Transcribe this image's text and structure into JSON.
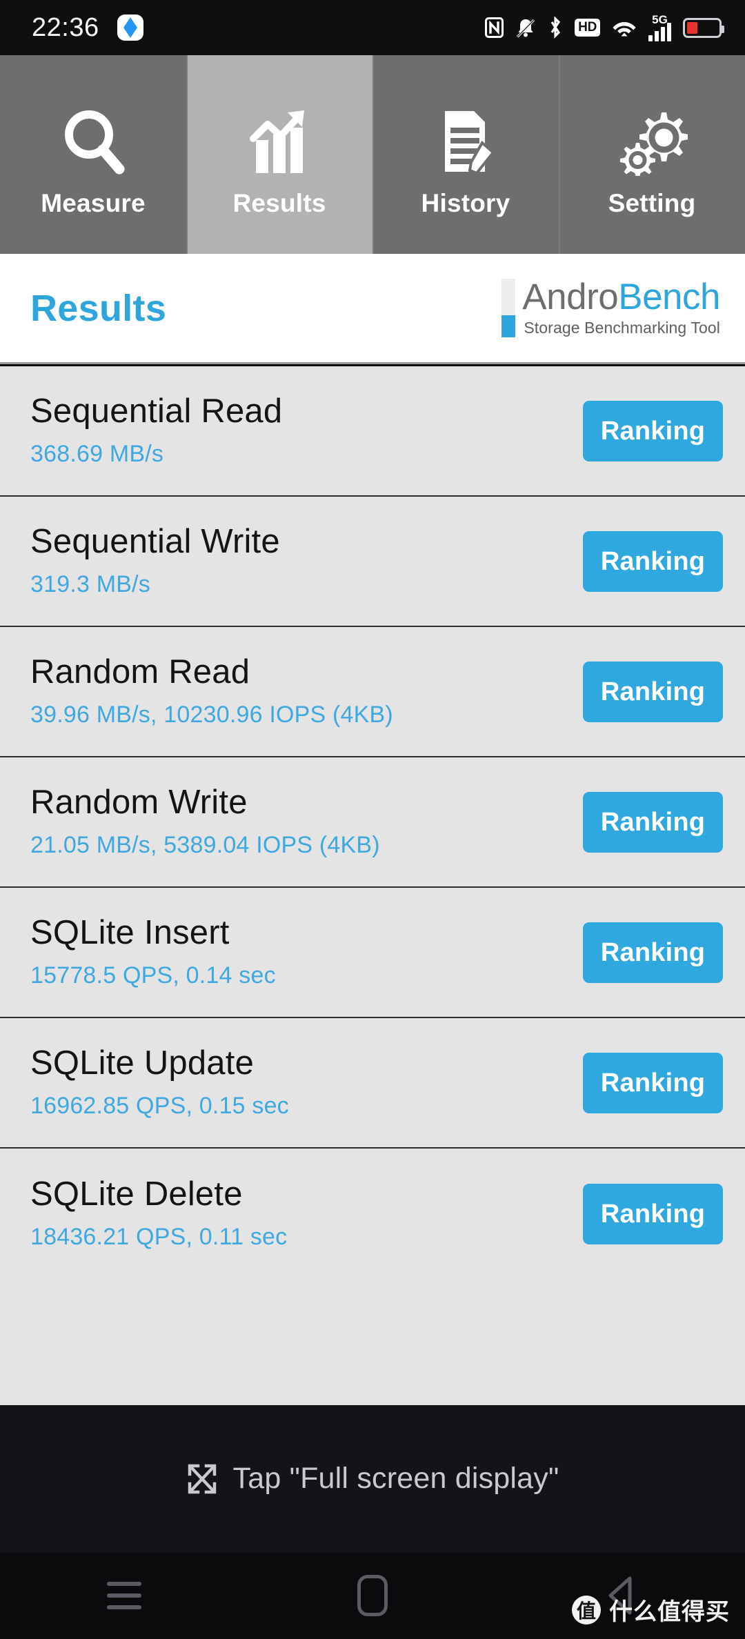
{
  "statusbar": {
    "time": "22:36",
    "app_icon": "app-badge-icon",
    "icons": [
      "nfc-icon",
      "bell-muted-icon",
      "bluetooth-icon",
      "hd-icon",
      "wifi-icon",
      "signal-5g-icon",
      "battery-low-icon"
    ],
    "hd_label": "HD",
    "network_label": "5G",
    "battery_color": "#e8342b",
    "battery_level_pct": 18
  },
  "tabs": [
    {
      "label": "Measure",
      "icon": "magnifier-icon",
      "selected": false
    },
    {
      "label": "Results",
      "icon": "bar-chart-arrow-icon",
      "selected": true
    },
    {
      "label": "History",
      "icon": "document-pen-icon",
      "selected": false
    },
    {
      "label": "Setting",
      "icon": "gears-icon",
      "selected": false
    }
  ],
  "header": {
    "title": "Results",
    "logo_prefix": "Andro",
    "logo_suffix": "Bench",
    "logo_subtitle": "Storage Benchmarking Tool",
    "accent_color": "#2ea6dd"
  },
  "results": {
    "button_label": "Ranking",
    "rows": [
      {
        "title": "Sequential Read",
        "value": "368.69 MB/s"
      },
      {
        "title": "Sequential Write",
        "value": "319.3 MB/s"
      },
      {
        "title": "Random Read",
        "value": "39.96 MB/s, 10230.96 IOPS (4KB)"
      },
      {
        "title": "Random Write",
        "value": "21.05 MB/s, 5389.04 IOPS (4KB)"
      },
      {
        "title": "SQLite Insert",
        "value": "15778.5 QPS, 0.14 sec"
      },
      {
        "title": "SQLite Update",
        "value": "16962.85 QPS, 0.15 sec"
      },
      {
        "title": "SQLite Delete",
        "value": "18436.21 QPS, 0.11 sec"
      }
    ]
  },
  "banner": {
    "icon": "fullscreen-expand-icon",
    "text": "Tap \"Full screen display\""
  },
  "navbar": {
    "recents": "menu-icon",
    "home": "home-icon",
    "back": "back-triangle-icon"
  },
  "watermark": {
    "logo": "值",
    "text": "什么值得买"
  }
}
